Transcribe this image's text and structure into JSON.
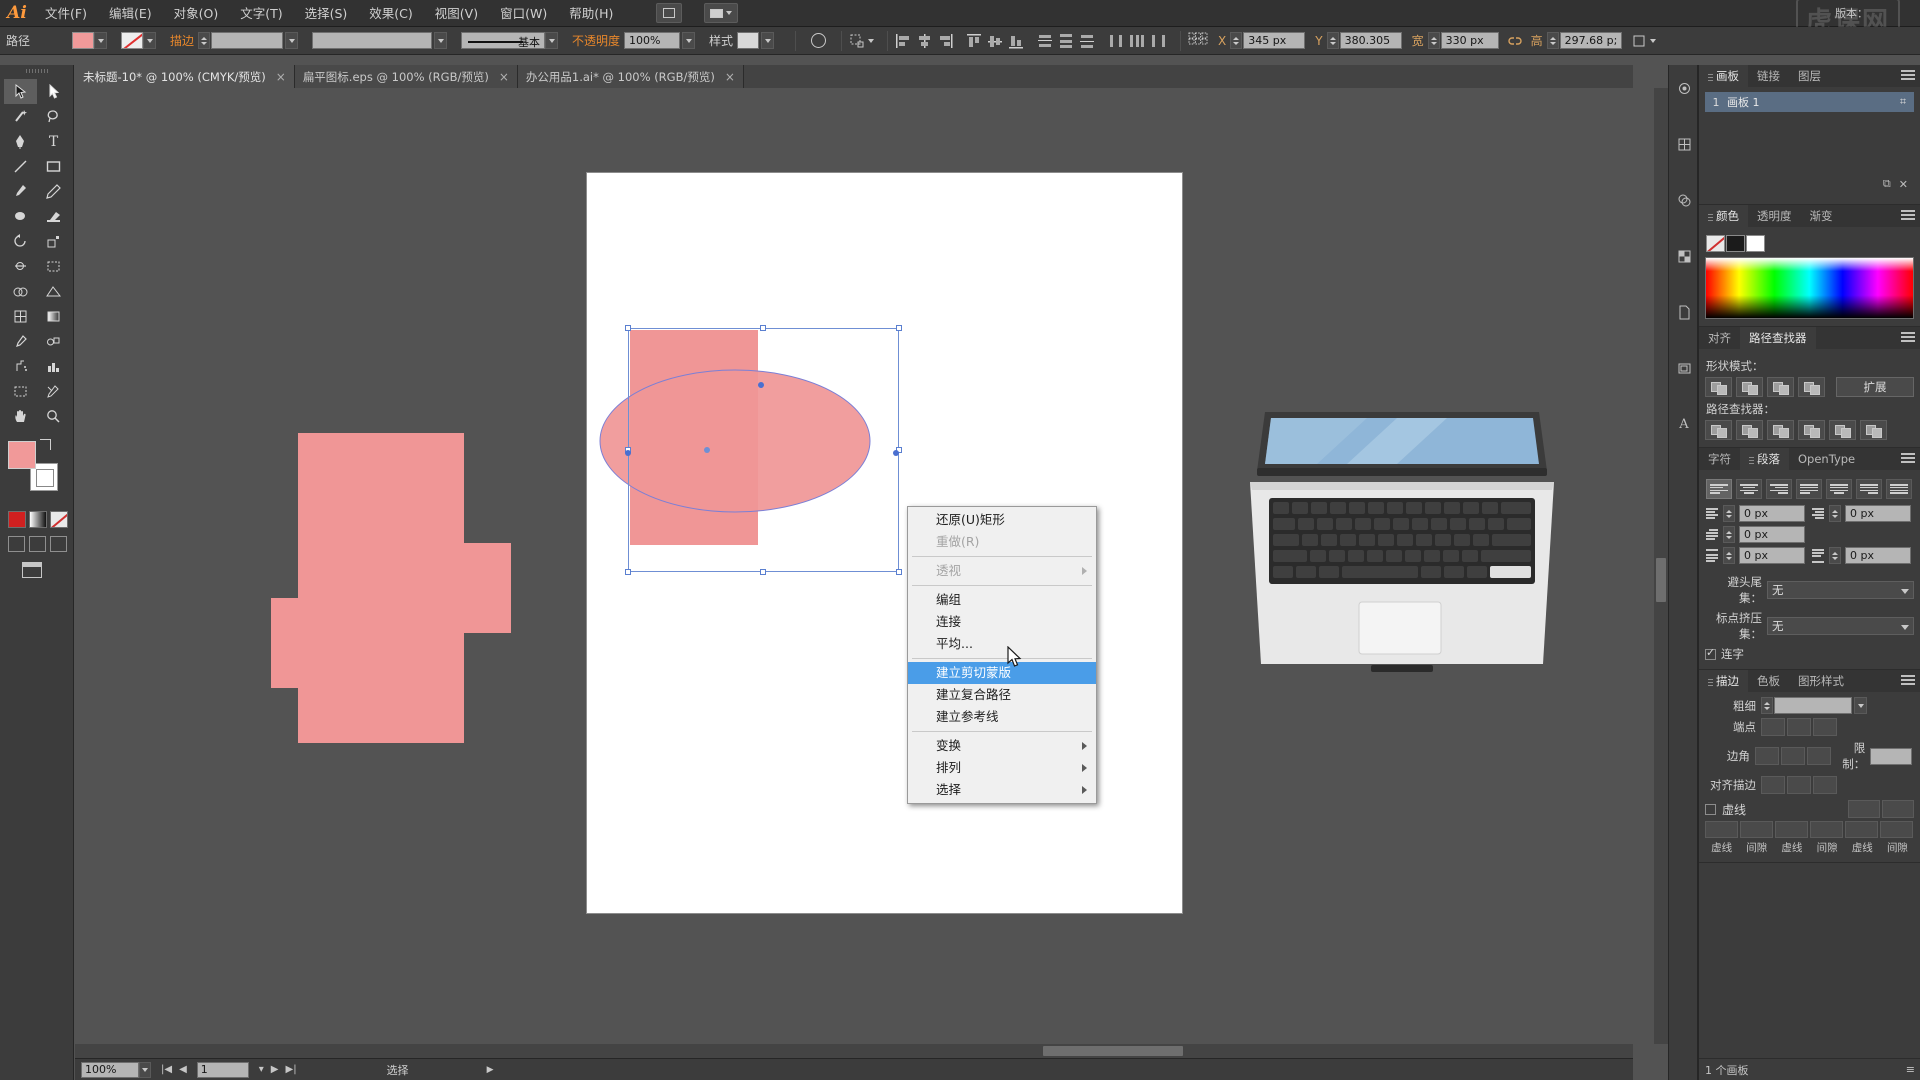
{
  "app": {
    "logo": "Ai",
    "workspace_label": "版本："
  },
  "menubar": {
    "items": [
      {
        "label": "文件(F)"
      },
      {
        "label": "编辑(E)"
      },
      {
        "label": "对象(O)"
      },
      {
        "label": "文字(T)"
      },
      {
        "label": "选择(S)"
      },
      {
        "label": "效果(C)"
      },
      {
        "label": "视图(V)"
      },
      {
        "label": "窗口(W)"
      },
      {
        "label": "帮助(H)"
      }
    ],
    "watermark": "虎课网"
  },
  "controlbar": {
    "object_label": "路径",
    "fill_color": "#f09a9a",
    "stroke_label": "描边",
    "stroke_weight": "",
    "stroke_profile": "",
    "brush_style_label": "基本",
    "opacity_label": "不透明度",
    "opacity_value": "100%",
    "style_label": "样式",
    "x_label": "X",
    "x_value": "345 px",
    "y_label": "Y",
    "y_value": "380.305",
    "w_label": "宽",
    "w_value": "330 px",
    "h_label": "高",
    "h_value": "297.68 p;"
  },
  "tabs": [
    {
      "label": "未标题-10* @ 100% (CMYK/预览)",
      "active": true,
      "close": "×"
    },
    {
      "label": "扁平图标.eps @ 100% (RGB/预览)",
      "active": false,
      "close": "×"
    },
    {
      "label": "办公用品1.ai* @ 100% (RGB/预览)",
      "active": false,
      "close": "×"
    }
  ],
  "toolbar": {
    "tools": [
      "selection-tool",
      "direct-selection-tool",
      "magic-wand-tool",
      "lasso-tool",
      "pen-tool",
      "type-tool",
      "line-segment-tool",
      "rectangle-tool",
      "paintbrush-tool",
      "pencil-tool",
      "blob-brush-tool",
      "eraser-tool",
      "rotate-tool",
      "scale-tool",
      "width-tool",
      "free-transform-tool",
      "shape-builder-tool",
      "perspective-grid-tool",
      "mesh-tool",
      "gradient-tool",
      "eyedropper-tool",
      "blend-tool",
      "symbol-sprayer-tool",
      "column-graph-tool",
      "artboard-tool",
      "slice-tool",
      "hand-tool",
      "zoom-tool"
    ],
    "fill_color": "#f19999",
    "stroke_color": "#ffffff"
  },
  "context_menu": {
    "items": [
      {
        "label": "还原(U)矩形",
        "state": "normal",
        "submenu": false
      },
      {
        "label": "重做(R)",
        "state": "disabled",
        "submenu": false
      },
      {
        "sep": true
      },
      {
        "label": "透视",
        "state": "disabled",
        "submenu": true
      },
      {
        "sep": true
      },
      {
        "label": "编组",
        "state": "normal",
        "submenu": false
      },
      {
        "label": "连接",
        "state": "normal",
        "submenu": false
      },
      {
        "label": "平均...",
        "state": "normal",
        "submenu": false
      },
      {
        "sep": true
      },
      {
        "label": "建立剪切蒙版",
        "state": "highlighted",
        "submenu": false
      },
      {
        "label": "建立复合路径",
        "state": "normal",
        "submenu": false
      },
      {
        "label": "建立参考线",
        "state": "normal",
        "submenu": false
      },
      {
        "sep": true
      },
      {
        "label": "变换",
        "state": "normal",
        "submenu": true
      },
      {
        "label": "排列",
        "state": "normal",
        "submenu": true
      },
      {
        "label": "选择",
        "state": "normal",
        "submenu": true
      }
    ]
  },
  "panels": {
    "artboards": {
      "tabs": [
        "画板",
        "链接",
        "图层"
      ],
      "active_tab": "画板",
      "rows": [
        {
          "num": "1",
          "name": "画板 1"
        }
      ]
    },
    "color": {
      "tabs": [
        "颜色",
        "透明度",
        "渐变"
      ],
      "active_tab": "颜色"
    },
    "pathfinder": {
      "tabs": [
        "对齐",
        "路径查找器"
      ],
      "active_tab": "路径查找器",
      "shape_modes_label": "形状模式：",
      "expand_label": "扩展",
      "pathfinder_label": "路径查找器："
    },
    "paragraph": {
      "tabs": [
        "字符",
        "段落",
        "OpenType"
      ],
      "active_tab": "段落",
      "indent_left": "0 px",
      "indent_right": "0 px",
      "indent_first": "0 px",
      "space_before": "0 px",
      "space_after": "0 px",
      "unit": "px",
      "kinsoku_label": "避头尾集：",
      "kinsoku_value": "无",
      "burasagari_label": "标点挤压集：",
      "burasagari_value": "无",
      "hyphenate_label": "连字",
      "hyphenate_checked": true
    },
    "stroke": {
      "tabs": [
        "描边",
        "色板",
        "图形样式"
      ],
      "active_tab": "描边",
      "weight_label": "粗细",
      "weight_value": "",
      "cap_label": "端点",
      "corner_label": "边角",
      "limit_label": "限制：",
      "limit_value": "",
      "align_label": "对齐描边",
      "dash_label": "虚线",
      "dash_fields": [
        "",
        "",
        "",
        "",
        "",
        ""
      ],
      "dash_field_labels": [
        "虚线",
        "间隙",
        "虚线",
        "间隙",
        "虚线",
        "间隙"
      ]
    },
    "footer": {
      "label": "1 个画板"
    }
  },
  "statusbar": {
    "zoom": "100%",
    "page": "1",
    "status_text": "选择"
  },
  "artwork": {
    "pink": "#f09696",
    "pink_stroke": "#ef9a9a",
    "laptop_screen_top": "#8fb6d8",
    "laptop_screen_bottom": "#b9d6ea",
    "laptop_body": "#e6e6e6",
    "laptop_key": "#2b2b2b",
    "laptop_bezel": "#3a3a3a"
  }
}
